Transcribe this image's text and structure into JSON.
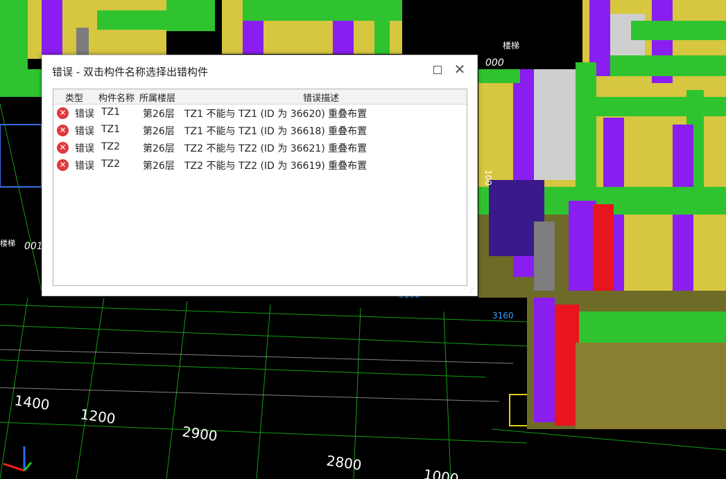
{
  "dialog": {
    "title": "错误 - 双击构件名称选择出错构件",
    "columns": {
      "type": "类型",
      "name": "构件名称",
      "floor": "所属楼层",
      "desc": "错误描述"
    },
    "rows": [
      {
        "type": "错误",
        "name": "TZ1",
        "floor": "第26层",
        "desc": "TZ1 不能与 TZ1 (ID 为 36620) 重叠布置"
      },
      {
        "type": "错误",
        "name": "TZ1",
        "floor": "第26层",
        "desc": "TZ1 不能与 TZ1 (ID 为 36618) 重叠布置"
      },
      {
        "type": "错误",
        "name": "TZ2",
        "floor": "第26层",
        "desc": "TZ2 不能与 TZ2 (ID 为 36621) 重叠布置"
      },
      {
        "type": "错误",
        "name": "TZ2",
        "floor": "第26层",
        "desc": "TZ2 不能与 TZ2 (ID 为 36619) 重叠布置"
      }
    ],
    "error_icon": "error-x-icon",
    "colors": {
      "error": "#e0393c"
    }
  },
  "viewport": {
    "dimensions": [
      "1400",
      "1200",
      "2900",
      "2800",
      "1000"
    ],
    "labels": [
      "000",
      "001",
      "100",
      "楼梯",
      "楼梯",
      "3160",
      "3160"
    ],
    "colors": {
      "beam": "#2fc42f",
      "wall": "#d6c640",
      "column": "#8a1ef0",
      "red": "#e8141e",
      "grid": "#18c818",
      "background": "#000000"
    }
  }
}
